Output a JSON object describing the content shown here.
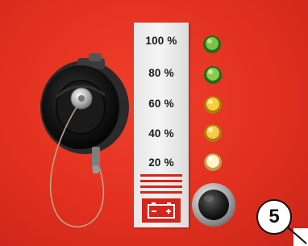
{
  "gauge": {
    "levels": [
      {
        "label": "100 %",
        "color": "#7dc04a"
      },
      {
        "label": "80 %",
        "color": "#8cc94f"
      },
      {
        "label": "60 %",
        "color": "#ffcf3a"
      },
      {
        "label": "40 %",
        "color": "#ffc84a"
      },
      {
        "label": "20 %",
        "color": "#fff2c8"
      }
    ]
  },
  "callout": {
    "number": "5"
  },
  "colors": {
    "panel_red": "#e2301f",
    "label_plate": "#eeeeee",
    "plate_red": "#d4261d"
  },
  "icons": [
    "battery-icon",
    "push-button",
    "charging-socket-cap"
  ]
}
